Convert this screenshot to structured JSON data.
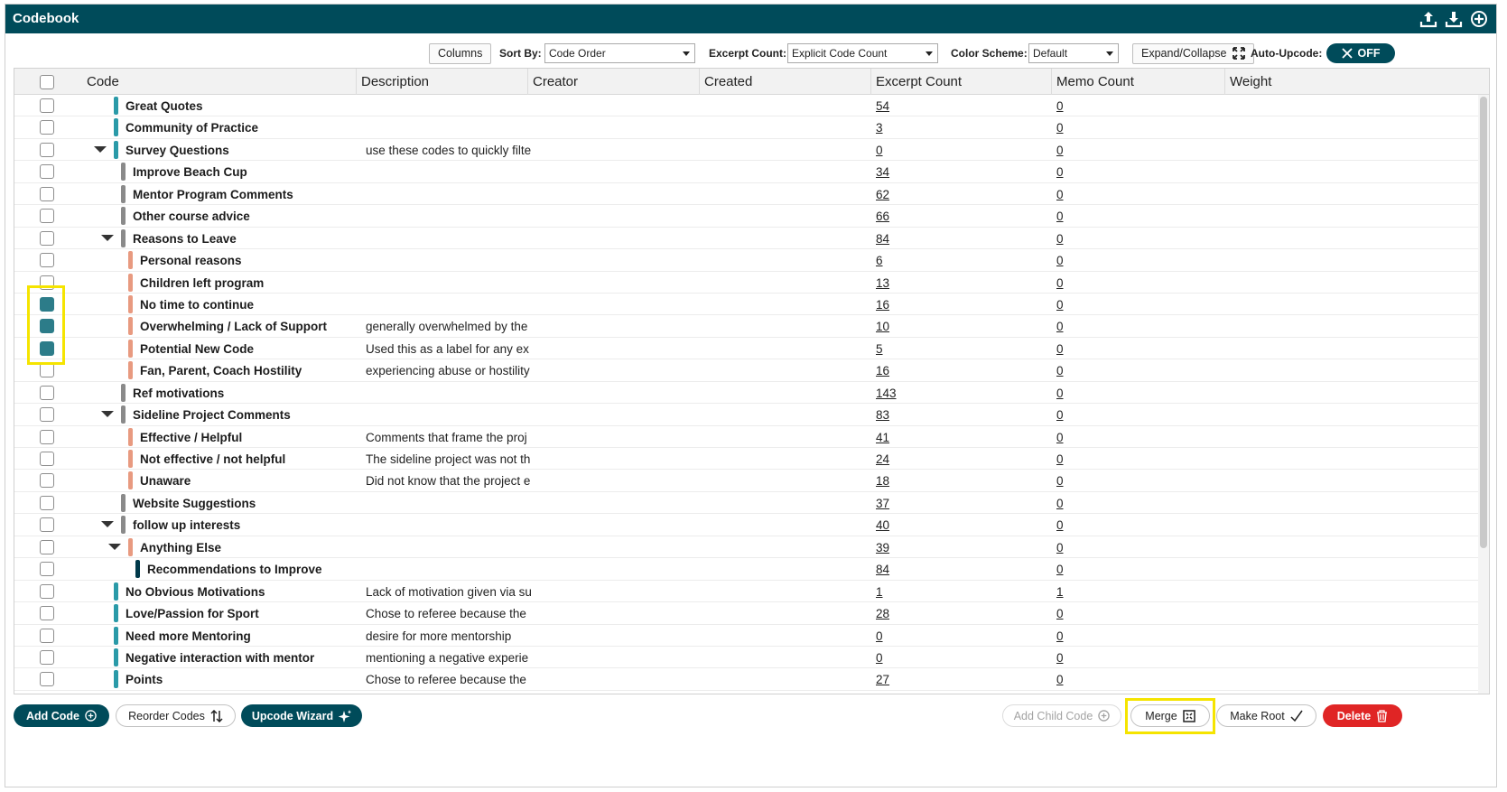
{
  "window": {
    "title": "Codebook"
  },
  "toolbar": {
    "columns_label": "Columns",
    "sort_by_label": "Sort By:",
    "sort_by_value": "Code Order",
    "excerpt_count_label": "Excerpt Count:",
    "excerpt_count_value": "Explicit Code Count",
    "color_scheme_label": "Color Scheme:",
    "color_scheme_value": "Default",
    "expand_collapse_label": "Expand/Collapse",
    "auto_upcode_label": "Auto-Upcode:",
    "auto_upcode_value": "OFF"
  },
  "columns": [
    "Code",
    "Description",
    "Creator",
    "Created",
    "Excerpt Count",
    "Memo Count",
    "Weight"
  ],
  "colors": {
    "header_bg": "#004b5a",
    "teal": "#2a9aa8",
    "gray": "#8a8a8a",
    "salmon": "#e89a80",
    "navy": "#00394a",
    "checked": "#2c7c89",
    "highlight": "#f5e400",
    "delete": "#e02525"
  },
  "rows": [
    {
      "name": "Great Quotes",
      "description": "",
      "excerpt_count": "54",
      "memo_count": "0",
      "checked": false,
      "level": 0,
      "color": "teal",
      "expandable": false
    },
    {
      "name": "Community of Practice",
      "description": "",
      "excerpt_count": "3",
      "memo_count": "0",
      "checked": false,
      "level": 0,
      "color": "teal",
      "expandable": false
    },
    {
      "name": "Survey Questions",
      "description": "use these codes to quickly filte",
      "excerpt_count": "0",
      "memo_count": "0",
      "checked": false,
      "level": 0,
      "color": "teal",
      "expandable": true
    },
    {
      "name": "Improve Beach Cup",
      "description": "",
      "excerpt_count": "34",
      "memo_count": "0",
      "checked": false,
      "level": 1,
      "color": "gray",
      "expandable": false
    },
    {
      "name": "Mentor Program Comments",
      "description": "",
      "excerpt_count": "62",
      "memo_count": "0",
      "checked": false,
      "level": 1,
      "color": "gray",
      "expandable": false
    },
    {
      "name": "Other course advice",
      "description": "",
      "excerpt_count": "66",
      "memo_count": "0",
      "checked": false,
      "level": 1,
      "color": "gray",
      "expandable": false
    },
    {
      "name": "Reasons to Leave",
      "description": "",
      "excerpt_count": "84",
      "memo_count": "0",
      "checked": false,
      "level": 1,
      "color": "gray",
      "expandable": true
    },
    {
      "name": "Personal reasons",
      "description": "",
      "excerpt_count": "6",
      "memo_count": "0",
      "checked": false,
      "level": 2,
      "color": "salmon",
      "expandable": false
    },
    {
      "name": "Children left program",
      "description": "",
      "excerpt_count": "13",
      "memo_count": "0",
      "checked": false,
      "level": 2,
      "color": "salmon",
      "expandable": false
    },
    {
      "name": "No time to continue",
      "description": "",
      "excerpt_count": "16",
      "memo_count": "0",
      "checked": true,
      "level": 2,
      "color": "salmon",
      "expandable": false
    },
    {
      "name": "Overwhelming / Lack of Support",
      "description": "generally overwhelmed by the",
      "excerpt_count": "10",
      "memo_count": "0",
      "checked": true,
      "level": 2,
      "color": "salmon",
      "expandable": false
    },
    {
      "name": "Potential New Code",
      "description": "Used this as a label for any ex",
      "excerpt_count": "5",
      "memo_count": "0",
      "checked": true,
      "level": 2,
      "color": "salmon",
      "expandable": false
    },
    {
      "name": "Fan, Parent, Coach Hostility",
      "description": "experiencing abuse or hostility",
      "excerpt_count": "16",
      "memo_count": "0",
      "checked": false,
      "level": 2,
      "color": "salmon",
      "expandable": false
    },
    {
      "name": "Ref motivations",
      "description": "",
      "excerpt_count": "143",
      "memo_count": "0",
      "checked": false,
      "level": 1,
      "color": "gray",
      "expandable": false
    },
    {
      "name": "Sideline Project Comments",
      "description": "",
      "excerpt_count": "83",
      "memo_count": "0",
      "checked": false,
      "level": 1,
      "color": "gray",
      "expandable": true
    },
    {
      "name": "Effective / Helpful",
      "description": "Comments that frame the proj",
      "excerpt_count": "41",
      "memo_count": "0",
      "checked": false,
      "level": 2,
      "color": "salmon",
      "expandable": false
    },
    {
      "name": "Not effective / not helpful",
      "description": "The sideline project was not th",
      "excerpt_count": "24",
      "memo_count": "0",
      "checked": false,
      "level": 2,
      "color": "salmon",
      "expandable": false
    },
    {
      "name": "Unaware",
      "description": "Did not know that the project e",
      "excerpt_count": "18",
      "memo_count": "0",
      "checked": false,
      "level": 2,
      "color": "salmon",
      "expandable": false
    },
    {
      "name": "Website Suggestions",
      "description": "",
      "excerpt_count": "37",
      "memo_count": "0",
      "checked": false,
      "level": 1,
      "color": "gray",
      "expandable": false
    },
    {
      "name": "follow up interests",
      "description": "",
      "excerpt_count": "40",
      "memo_count": "0",
      "checked": false,
      "level": 1,
      "color": "gray",
      "expandable": true
    },
    {
      "name": "Anything Else",
      "description": "",
      "excerpt_count": "39",
      "memo_count": "0",
      "checked": false,
      "level": 2,
      "color": "salmon",
      "expandable": true
    },
    {
      "name": "Recommendations to Improve",
      "description": "",
      "excerpt_count": "84",
      "memo_count": "0",
      "checked": false,
      "level": 3,
      "color": "navy",
      "expandable": false
    },
    {
      "name": "No Obvious Motivations",
      "description": "Lack of motivation given via su",
      "excerpt_count": "1",
      "memo_count": "1",
      "checked": false,
      "level": 0,
      "color": "teal",
      "expandable": false
    },
    {
      "name": "Love/Passion for Sport",
      "description": "Chose to referee because the",
      "excerpt_count": "28",
      "memo_count": "0",
      "checked": false,
      "level": 0,
      "color": "teal",
      "expandable": false
    },
    {
      "name": "Need more Mentoring",
      "description": "desire for more mentorship",
      "excerpt_count": "0",
      "memo_count": "0",
      "checked": false,
      "level": 0,
      "color": "teal",
      "expandable": false
    },
    {
      "name": "Negative interaction with mentor",
      "description": "mentioning a negative experie",
      "excerpt_count": "0",
      "memo_count": "0",
      "checked": false,
      "level": 0,
      "color": "teal",
      "expandable": false
    },
    {
      "name": "Points",
      "description": "Chose to referee because the",
      "excerpt_count": "27",
      "memo_count": "0",
      "checked": false,
      "level": 0,
      "color": "teal",
      "expandable": false
    }
  ],
  "footer": {
    "add_code": "Add Code",
    "reorder_codes": "Reorder Codes",
    "upcode_wizard": "Upcode Wizard",
    "add_child_code": "Add Child Code",
    "merge": "Merge",
    "make_root": "Make Root",
    "delete": "Delete"
  },
  "icons": {
    "titlebar": [
      "upload-icon",
      "download-icon",
      "add-circle-icon"
    ]
  }
}
